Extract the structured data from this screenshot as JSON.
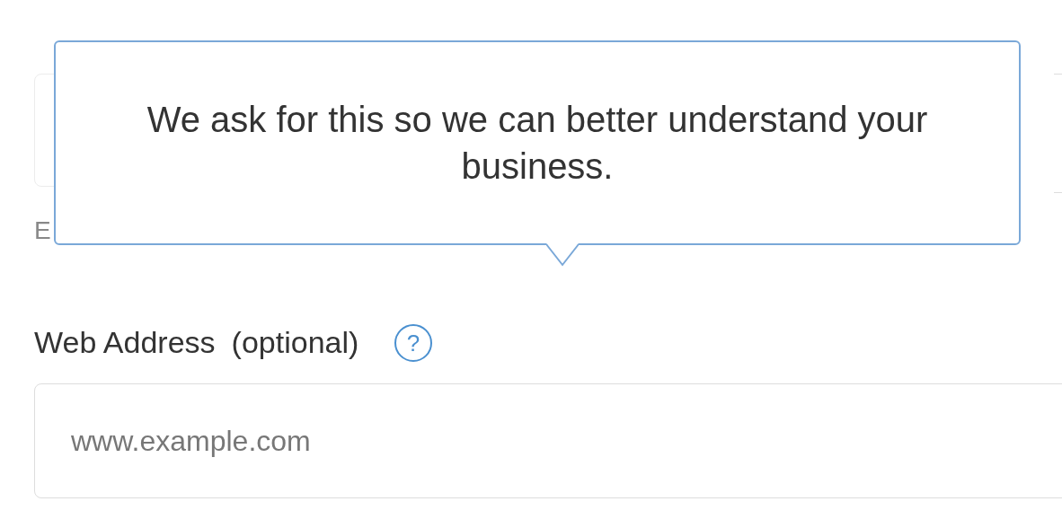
{
  "phone": {
    "hint": "E"
  },
  "tooltip": {
    "text": "We ask for this so we can better understand your business."
  },
  "web_address": {
    "label": "Web Address",
    "note": "(optional)",
    "help": "?",
    "placeholder": "www.example.com"
  }
}
